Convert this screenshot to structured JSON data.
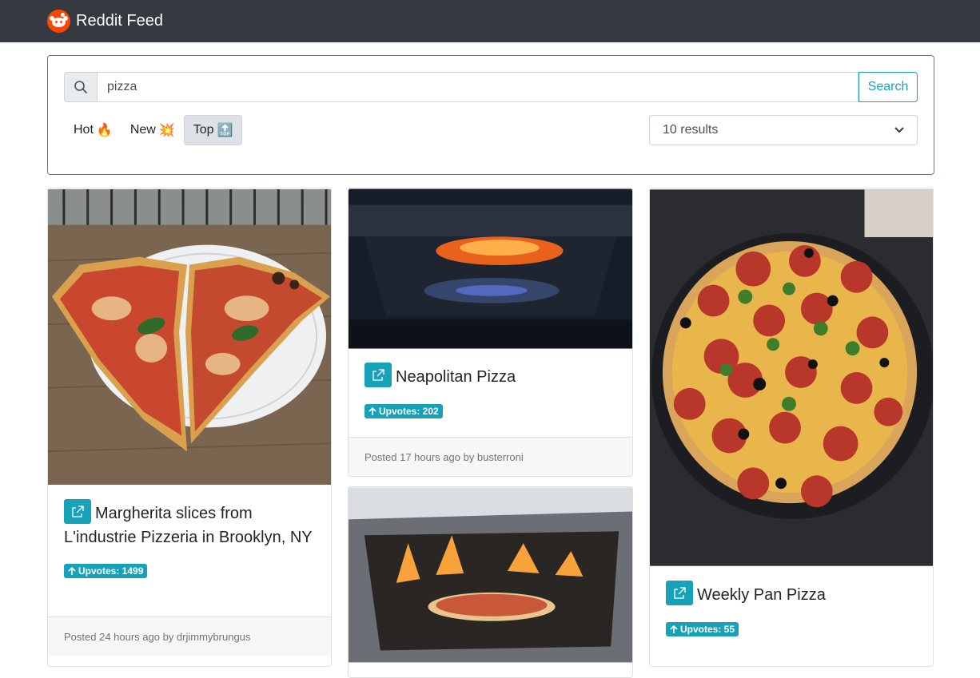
{
  "navbar": {
    "brand": "Reddit Feed",
    "logo_icon": "reddit-logo-icon"
  },
  "search": {
    "value": "pizza",
    "placeholder": "",
    "button_label": "Search"
  },
  "sort_tabs": [
    {
      "label": "Hot",
      "emoji": "🔥"
    },
    {
      "label": "New",
      "emoji": "💥"
    },
    {
      "label": "Top",
      "emoji": "🔝",
      "active": true
    }
  ],
  "results_select": {
    "selected": "10 results"
  },
  "posts": [
    {
      "title": "Margherita slices from L'industrie Pizzeria in Brooklyn, NY",
      "upvotes_label": "Upvotes: 1499",
      "footer": "Posted 24 hours ago by drjimmybrungus"
    },
    {
      "title": "Neapolitan Pizza",
      "upvotes_label": "Upvotes: 202",
      "footer": "Posted 17 hours ago by busterroni"
    },
    {
      "title": "",
      "upvotes_label": "",
      "footer": ""
    },
    {
      "title": "Weekly Pan Pizza",
      "upvotes_label": "Upvotes: 55",
      "footer": ""
    }
  ],
  "colors": {
    "navbar": "#343a40",
    "accent": "#17a2b8",
    "reddit": "#ff4500"
  }
}
